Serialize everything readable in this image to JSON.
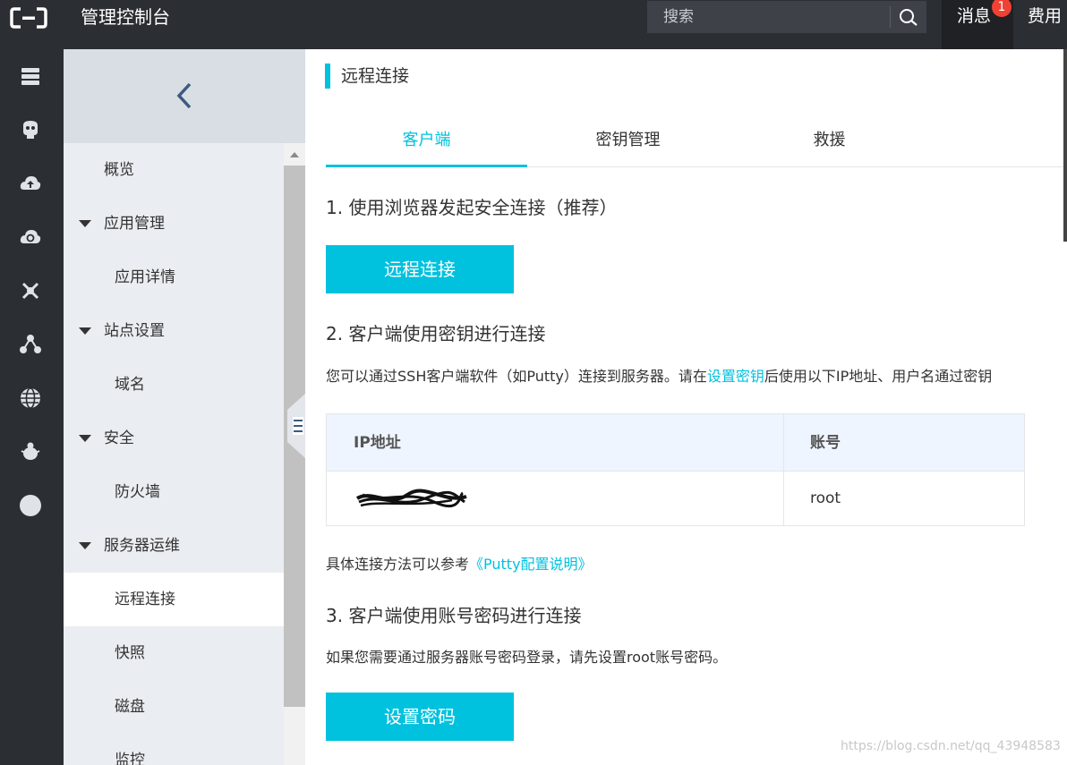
{
  "header": {
    "app_title": "管理控制台",
    "search_placeholder": "搜索",
    "messages_label": "消息",
    "messages_count": "1",
    "fees_label": "费用"
  },
  "rail": {
    "icons": [
      "server-icon",
      "cloud-db-icon",
      "cloud-upload-icon",
      "cloud-refresh-icon",
      "network-nodes-icon",
      "cluster-icon",
      "globe-icon",
      "bug-icon",
      "circle-icon"
    ]
  },
  "sidebar": {
    "items": [
      {
        "label": "概览",
        "kind": "top"
      },
      {
        "label": "应用管理",
        "kind": "group"
      },
      {
        "label": "应用详情",
        "kind": "sub"
      },
      {
        "label": "站点设置",
        "kind": "group"
      },
      {
        "label": "域名",
        "kind": "sub"
      },
      {
        "label": "安全",
        "kind": "group"
      },
      {
        "label": "防火墙",
        "kind": "sub"
      },
      {
        "label": "服务器运维",
        "kind": "group"
      },
      {
        "label": "远程连接",
        "kind": "sub",
        "active": true
      },
      {
        "label": "快照",
        "kind": "sub"
      },
      {
        "label": "磁盘",
        "kind": "sub"
      },
      {
        "label": "监控",
        "kind": "sub"
      }
    ]
  },
  "main": {
    "page_title": "远程连接",
    "tabs": [
      {
        "label": "客户端",
        "active": true
      },
      {
        "label": "密钥管理",
        "active": false
      },
      {
        "label": "救援",
        "active": false
      }
    ],
    "section1_title": "1. 使用浏览器发起安全连接（推荐）",
    "remote_connect_button": "远程连接",
    "section2_title": "2. 客户端使用密钥进行连接",
    "section2_desc_prefix": "您可以通过SSH客户端软件（如Putty）连接到服务器。请在",
    "section2_desc_link": "设置密钥",
    "section2_desc_suffix": "后使用以下IP地址、用户名通过密钥",
    "table": {
      "headers": [
        "IP地址",
        "账号"
      ],
      "rows": [
        [
          "",
          "root"
        ]
      ]
    },
    "ref_prefix": "具体连接方法可以参考",
    "ref_link": "《Putty配置说明》",
    "section3_title": "3. 客户端使用账号密码进行连接",
    "section3_desc": "如果您需要通过服务器账号密码登录，请先设置root账号密码。",
    "set_password_button": "设置密码"
  },
  "watermark": "https://blog.csdn.net/qq_43948583",
  "colors": {
    "accent": "#00c1de",
    "topbar": "#2b2e33",
    "badge": "#f04134"
  }
}
